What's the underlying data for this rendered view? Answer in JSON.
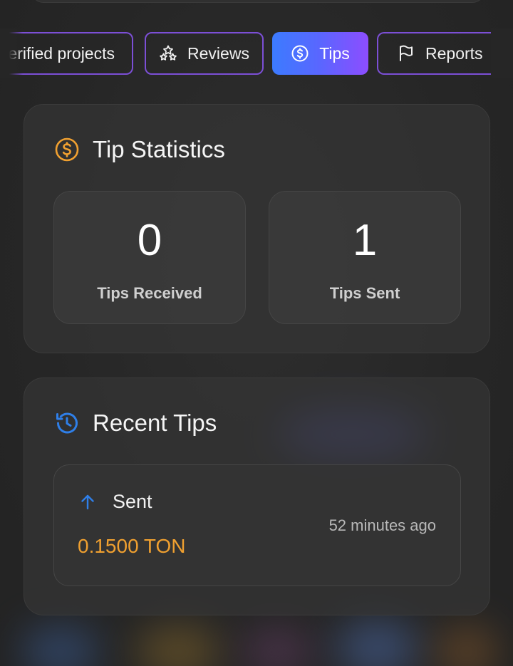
{
  "tabs": [
    {
      "label": "erified projects",
      "icon": "none",
      "active": false
    },
    {
      "label": "Reviews",
      "icon": "stars-icon",
      "active": false
    },
    {
      "label": "Tips",
      "icon": "dollar-coin-icon",
      "active": true
    },
    {
      "label": "Reports",
      "icon": "flag-icon",
      "active": false
    }
  ],
  "tip_statistics": {
    "title": "Tip Statistics",
    "icon": "dollar-coin-icon",
    "received_value": "0",
    "received_label": "Tips Received",
    "sent_value": "1",
    "sent_label": "Tips Sent"
  },
  "recent_tips": {
    "title": "Recent Tips",
    "icon": "history-icon",
    "items": [
      {
        "direction": "Sent",
        "amount": "0.1500 TON",
        "time": "52 minutes ago"
      }
    ]
  },
  "colors": {
    "accent_orange": "#f0a030",
    "accent_blue": "#2f7fe8",
    "tab_border": "#7c4fd6",
    "active_gradient_start": "#3c7bff",
    "active_gradient_end": "#8d4dff"
  }
}
